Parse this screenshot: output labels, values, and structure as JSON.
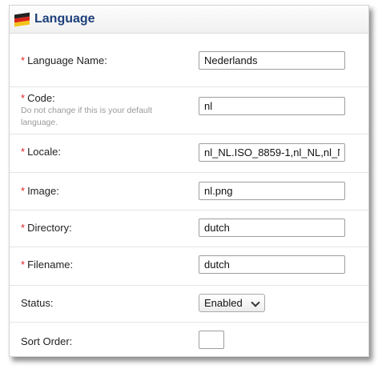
{
  "header": {
    "title": "Language",
    "icon": "flag-icon"
  },
  "form": {
    "required_marker": "*",
    "language_name": {
      "label": "Language Name:",
      "value": "Nederlands"
    },
    "code": {
      "label": "Code:",
      "help": "Do not change if this is your default language.",
      "value": "nl"
    },
    "locale": {
      "label": "Locale:",
      "value": "nl_NL.ISO_8859-1,nl_NL,nl_N"
    },
    "image": {
      "label": "Image:",
      "value": "nl.png"
    },
    "directory": {
      "label": "Directory:",
      "value": "dutch"
    },
    "filename": {
      "label": "Filename:",
      "value": "dutch"
    },
    "status": {
      "label": "Status:",
      "value": "Enabled"
    },
    "sort_order": {
      "label": "Sort Order:",
      "value": ""
    }
  },
  "colors": {
    "required": "#e02020",
    "title": "#1c3f7a",
    "help_text": "#9a9a9a"
  }
}
